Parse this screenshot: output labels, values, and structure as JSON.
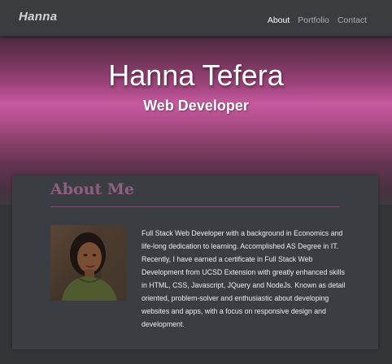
{
  "navbar": {
    "brand": "Hanna",
    "links": [
      "About",
      "Portfolio",
      "Contact"
    ],
    "active": "About"
  },
  "hero": {
    "title": "Hanna Tefera",
    "subtitle": "Web Developer"
  },
  "about": {
    "heading": "About Me",
    "photo_alt": "profile-photo",
    "body": "Full Stack Web Developer with a background in Economics and life-long dedication to learning. Accomplished AS Degree in IT. Recently, I have earned a certificate in Full Stack Web Development from UCSD Extension with greatly enhanced skills in HTML, CSS, Javascript, JQuery and NodeJs. Known as detail oriented, problem-solver and enthusiastic about developing websites and apps, with a focus on responsive design and development."
  },
  "colors": {
    "navbar_bg": "#3a3d40",
    "hero_pink": "#c6599f",
    "accent": "#8f5e81",
    "page_bg": "#343536"
  }
}
